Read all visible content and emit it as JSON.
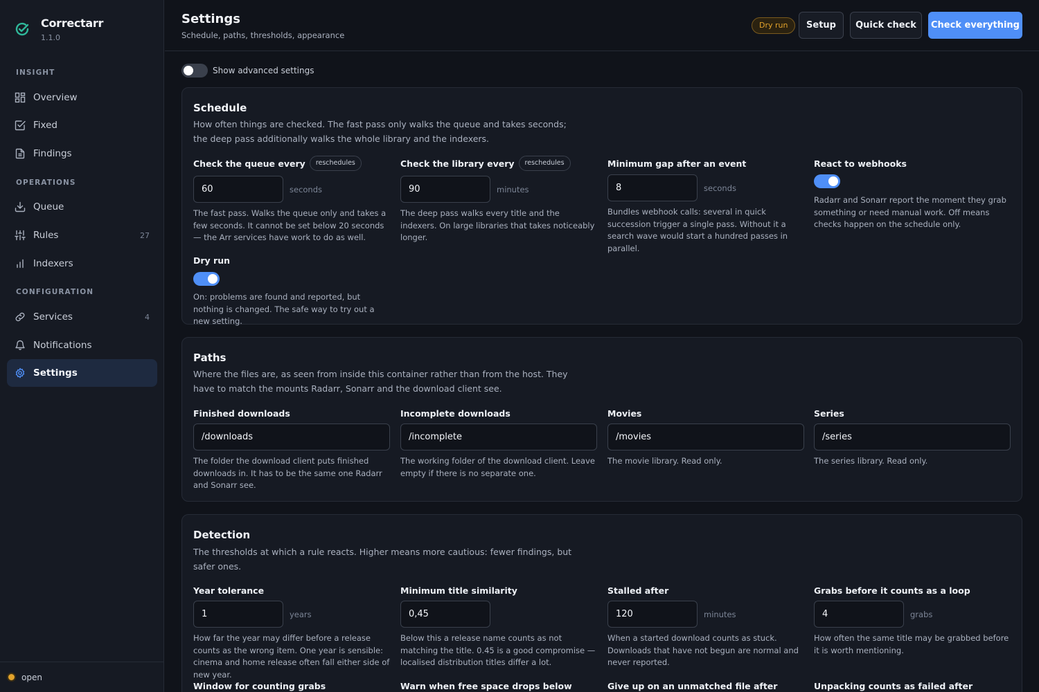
{
  "app": {
    "name": "Correctarr",
    "version": "1.1.0",
    "accent": "#4f8ff7",
    "logo_color": "#2fb89a"
  },
  "sidebar": {
    "sections": [
      {
        "title": "INSIGHT"
      },
      {
        "title": "OPERATIONS"
      },
      {
        "title": "CONFIGURATION"
      }
    ],
    "items": [
      {
        "label": "Overview",
        "icon": "grid-icon"
      },
      {
        "label": "Fixed",
        "icon": "check-square-icon"
      },
      {
        "label": "Findings",
        "icon": "document-icon"
      },
      {
        "label": "Queue",
        "icon": "download-icon"
      },
      {
        "label": "Rules",
        "icon": "sliders-icon",
        "count": "27"
      },
      {
        "label": "Indexers",
        "icon": "bar-chart-icon"
      },
      {
        "label": "Services",
        "icon": "link-icon",
        "count": "4"
      },
      {
        "label": "Notifications",
        "icon": "bell-icon"
      },
      {
        "label": "Settings",
        "icon": "gear-icon",
        "active": true
      }
    ],
    "footer_status": "open"
  },
  "header": {
    "title": "Settings",
    "subtitle": "Schedule, paths, thresholds, appearance",
    "badge": "Dry run",
    "buttons": {
      "setup": "Setup",
      "quick_check": "Quick check",
      "check_everything": "Check everything"
    }
  },
  "advanced_toggle": {
    "label": "Show advanced settings",
    "on": false
  },
  "schedule": {
    "title": "Schedule",
    "description": "How often things are checked. The fast pass only walks the queue and takes seconds; the deep pass additionally walks the whole library and the indexers.",
    "queue": {
      "label": "Check the queue every",
      "tag": "reschedules",
      "value": "60",
      "unit": "seconds",
      "help": "The fast pass. Walks the queue only and takes a few seconds. It cannot be set below 20 seconds — the Arr services have work to do as well."
    },
    "library": {
      "label": "Check the library every",
      "tag": "reschedules",
      "value": "90",
      "unit": "minutes",
      "help": "The deep pass walks every title and the indexers. On large libraries that takes noticeably longer."
    },
    "min_gap": {
      "label": "Minimum gap after an event",
      "value": "8",
      "unit": "seconds",
      "help": "Bundles webhook calls: several in quick succession trigger a single pass. Without it a search wave would start a hundred passes in parallel."
    },
    "webhooks": {
      "label": "React to webhooks",
      "on": true,
      "help": "Radarr and Sonarr report the moment they grab something or need manual work. Off means checks happen on the schedule only."
    },
    "dry_run": {
      "label": "Dry run",
      "on": true,
      "help": "On: problems are found and reported, but nothing is changed. The safe way to try out a new setting."
    }
  },
  "paths": {
    "title": "Paths",
    "description": "Where the files are, as seen from inside this container rather than from the host. They have to match the mounts Radarr, Sonarr and the download client see.",
    "finished": {
      "label": "Finished downloads",
      "value": "/downloads",
      "help": "The folder the download client puts finished downloads in. It has to be the same one Radarr and Sonarr see."
    },
    "incomplete": {
      "label": "Incomplete downloads",
      "value": "/incomplete",
      "help": "The working folder of the download client. Leave empty if there is no separate one."
    },
    "movies": {
      "label": "Movies",
      "value": "/movies",
      "help": "The movie library. Read only."
    },
    "series": {
      "label": "Series",
      "value": "/series",
      "help": "The series library. Read only."
    }
  },
  "detection": {
    "title": "Detection",
    "description": "The thresholds at which a rule reacts. Higher means more cautious: fewer findings, but safer ones.",
    "year_tolerance": {
      "label": "Year tolerance",
      "value": "1",
      "unit": "years",
      "help": "How far the year may differ before a release counts as the wrong item. One year is sensible: cinema and home release often fall either side of new year."
    },
    "title_similarity": {
      "label": "Minimum title similarity",
      "value": "0,45",
      "help": "Below this a release name counts as not matching the title. 0.45 is a good compromise — localised distribution titles differ a lot."
    },
    "stalled_after": {
      "label": "Stalled after",
      "value": "120",
      "unit": "minutes",
      "help": "When a started download counts as stuck. Downloads that have not begun are normal and never reported."
    },
    "grabs_loop": {
      "label": "Grabs before it counts as a loop",
      "value": "4",
      "unit": "grabs",
      "help": "How often the same title may be grabbed before it is worth mentioning."
    },
    "next_labels": {
      "window": "Window for counting grabs",
      "free_space": "Warn when free space drops below",
      "unmatched": "Give up on an unmatched file after",
      "unpacking": "Unpacking counts as failed after"
    }
  }
}
